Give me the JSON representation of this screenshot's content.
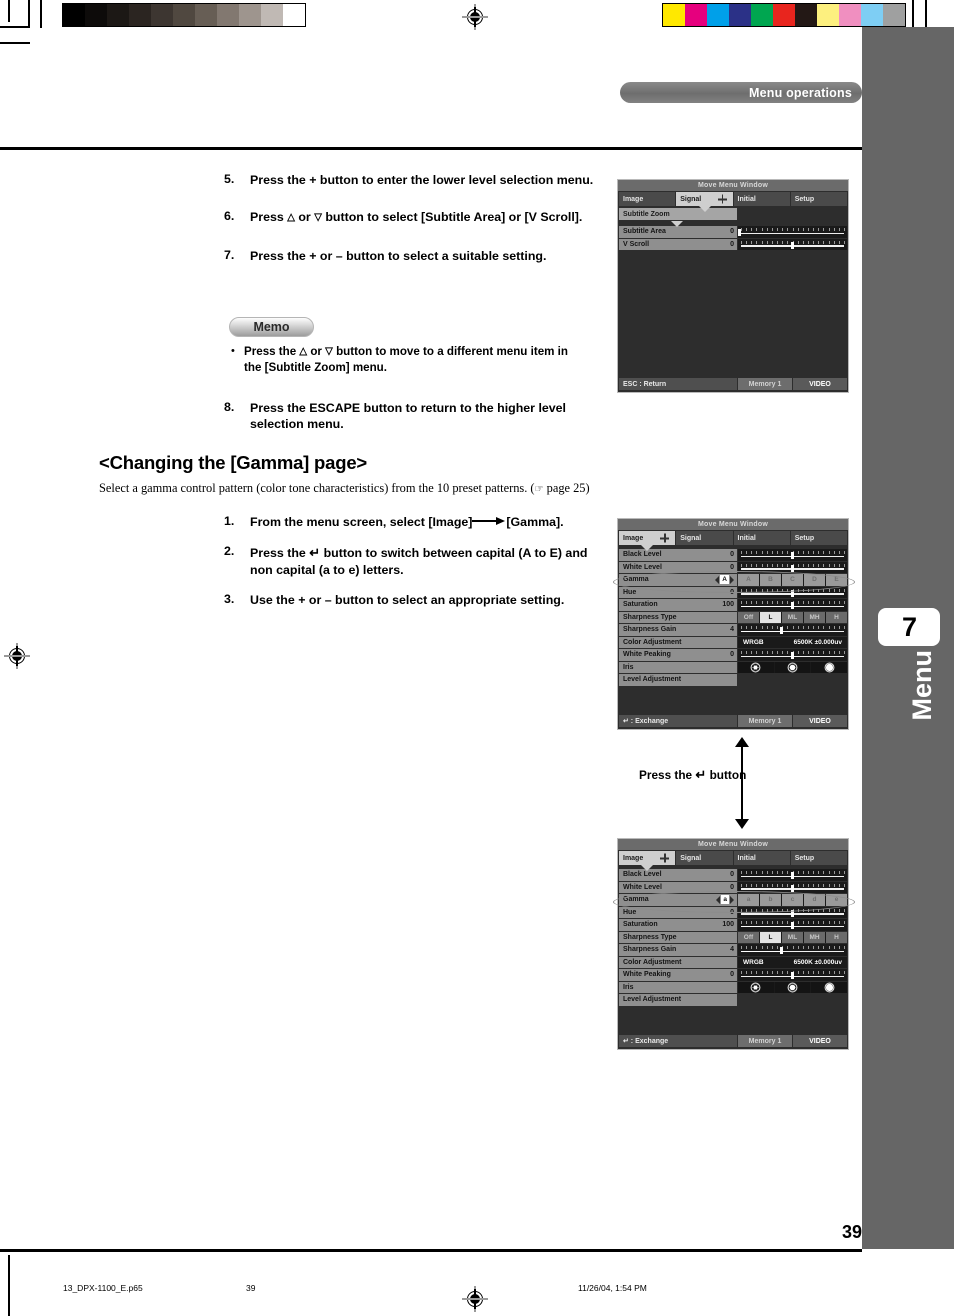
{
  "page": {
    "header_title": "Menu operations",
    "chapter_number": "7",
    "chapter_label": "Menu",
    "page_number": "39",
    "footer_file": "13_DPX-1100_E.p65",
    "footer_page": "39",
    "footer_date": "11/26/04, 1:54 PM"
  },
  "steps_top": [
    {
      "num": "5.",
      "text": "Press the + button to enter the lower level selection menu."
    },
    {
      "num": "6.",
      "text_before": "Press ",
      "tri_up": "△",
      "text_mid": " or ",
      "tri_dn": "▽",
      "text_after": " button to select [Subtitle Area] or [V Scroll]."
    },
    {
      "num": "7.",
      "text": "Press the + or – button to select a suitable setting."
    }
  ],
  "memo": {
    "label": "Memo",
    "bullet": "•",
    "text_before": "Press the ",
    "tri_up": "△",
    "text_mid": " or ",
    "tri_dn": "▽",
    "text_after": " button to move to a different menu item in the [Subtitle Zoom] menu."
  },
  "step8": {
    "num": "8.",
    "text": "Press the ESCAPE button to return to the higher level selection menu."
  },
  "section": {
    "heading": "<Changing the [Gamma] page>",
    "intro_before": "Select a gamma control pattern (color tone characteristics) from the 10 preset patterns. (",
    "intro_hand": "☞",
    "intro_after": " page 25)"
  },
  "steps_gamma": [
    {
      "num": "1.",
      "text_before": "From the menu screen, select [Image]",
      "text_after": "[Gamma]."
    },
    {
      "num": "2.",
      "text_before": "Press the ",
      "glyph": "↵",
      "text_after": " button to switch between capital (A to E) and non capital (a to e) letters."
    },
    {
      "num": "3.",
      "text": "Use the + or – button to select an appropriate setting."
    }
  ],
  "press_note": {
    "text_before": "Press the ",
    "glyph": "↵",
    "text_after": " button"
  },
  "osd_subtitle": {
    "title": "Move Menu Window",
    "tabs": [
      {
        "label": "Image",
        "active": false,
        "cross": false
      },
      {
        "label": "Signal",
        "active": true,
        "cross": true
      },
      {
        "label": "Initial",
        "active": false,
        "cross": false
      },
      {
        "label": "Setup",
        "active": false,
        "cross": false
      }
    ],
    "submenu": "Subtitle Zoom",
    "rows": [
      {
        "label": "Subtitle Area",
        "value": "0",
        "type": "slider",
        "knob_pct": 1,
        "fill_pct": 0
      },
      {
        "label": "V Scroll",
        "value": "0",
        "type": "slider",
        "knob_pct": 50,
        "fill_pct": 0
      }
    ],
    "footer": {
      "left": "ESC : Return",
      "mid": "Memory 1",
      "right": "VIDEO"
    }
  },
  "osd_gamma_upper": {
    "title": "Move Menu Window",
    "tabs": [
      {
        "label": "Image",
        "active": true,
        "cross": true
      },
      {
        "label": "Signal",
        "active": false,
        "cross": false
      },
      {
        "label": "Initial",
        "active": false,
        "cross": false
      },
      {
        "label": "Setup",
        "active": false,
        "cross": false
      }
    ],
    "rows": [
      {
        "label": "Black Level",
        "value": "0",
        "type": "slider",
        "knob_pct": 50,
        "fill_pct": 0
      },
      {
        "label": "White Level",
        "value": "0",
        "type": "slider",
        "knob_pct": 50,
        "fill_pct": 0
      },
      {
        "label": "Gamma",
        "value": "A",
        "type": "letters",
        "options": [
          "A",
          "B",
          "C",
          "D",
          "E"
        ],
        "selected": "A"
      },
      {
        "label": "Hue",
        "value": "0",
        "type": "slider",
        "knob_pct": 50,
        "fill_pct": 0
      },
      {
        "label": "Saturation",
        "value": "100",
        "type": "slider",
        "knob_pct": 50,
        "fill_pct": 50
      },
      {
        "label": "Sharpness Type",
        "value": "",
        "type": "segments",
        "options": [
          "Off",
          "L",
          "ML",
          "MH",
          "H"
        ],
        "selected": "L"
      },
      {
        "label": "Sharpness Gain",
        "value": "4",
        "type": "slider",
        "knob_pct": 40,
        "fill_pct": 40
      },
      {
        "label": "Color Adjustment",
        "value": "",
        "type": "text",
        "text_left": "WRGB",
        "text_right": "6500K ±0.000uv"
      },
      {
        "label": "White Peaking",
        "value": "0",
        "type": "slider",
        "knob_pct": 50,
        "fill_pct": 0
      },
      {
        "label": "Iris",
        "value": "",
        "type": "iris"
      },
      {
        "label": "Level Adjustment",
        "value": "",
        "type": "empty"
      }
    ],
    "footer": {
      "left": "↵ : Exchange",
      "mid": "Memory 1",
      "right": "VIDEO"
    }
  },
  "osd_gamma_lower": {
    "title": "Move Menu Window",
    "tabs": [
      {
        "label": "Image",
        "active": true,
        "cross": true
      },
      {
        "label": "Signal",
        "active": false,
        "cross": false
      },
      {
        "label": "Initial",
        "active": false,
        "cross": false
      },
      {
        "label": "Setup",
        "active": false,
        "cross": false
      }
    ],
    "rows": [
      {
        "label": "Black Level",
        "value": "0",
        "type": "slider",
        "knob_pct": 50,
        "fill_pct": 0
      },
      {
        "label": "White Level",
        "value": "0",
        "type": "slider",
        "knob_pct": 50,
        "fill_pct": 0
      },
      {
        "label": "Gamma",
        "value": "a",
        "type": "letters",
        "options": [
          "a",
          "b",
          "c",
          "d",
          "e"
        ],
        "selected": "a"
      },
      {
        "label": "Hue",
        "value": "0",
        "type": "slider",
        "knob_pct": 50,
        "fill_pct": 0
      },
      {
        "label": "Saturation",
        "value": "100",
        "type": "slider",
        "knob_pct": 50,
        "fill_pct": 50
      },
      {
        "label": "Sharpness Type",
        "value": "",
        "type": "segments",
        "options": [
          "Off",
          "L",
          "ML",
          "MH",
          "H"
        ],
        "selected": "L"
      },
      {
        "label": "Sharpness Gain",
        "value": "4",
        "type": "slider",
        "knob_pct": 40,
        "fill_pct": 40
      },
      {
        "label": "Color Adjustment",
        "value": "",
        "type": "text",
        "text_left": "WRGB",
        "text_right": "6500K ±0.000uv"
      },
      {
        "label": "White Peaking",
        "value": "0",
        "type": "slider",
        "knob_pct": 50,
        "fill_pct": 0
      },
      {
        "label": "Iris",
        "value": "",
        "type": "iris"
      },
      {
        "label": "Level Adjustment",
        "value": "",
        "type": "empty"
      }
    ],
    "footer": {
      "left": "↵ : Exchange",
      "mid": "Memory 1",
      "right": "VIDEO"
    }
  },
  "calibration": {
    "gray_swatches": [
      "#000000",
      "#0d0b0a",
      "#1c1815",
      "#2b2521",
      "#3d3631",
      "#504840",
      "#675e55",
      "#827870",
      "#9e958e",
      "#c0b9b4",
      "#ffffff"
    ],
    "color_swatches": [
      "#ffe800",
      "#e6007e",
      "#00a0e9",
      "#2b3187",
      "#00a650",
      "#e8251e",
      "#231815",
      "#fdf07f",
      "#f08fc0",
      "#7ecef4",
      "#9fa0a0"
    ]
  }
}
